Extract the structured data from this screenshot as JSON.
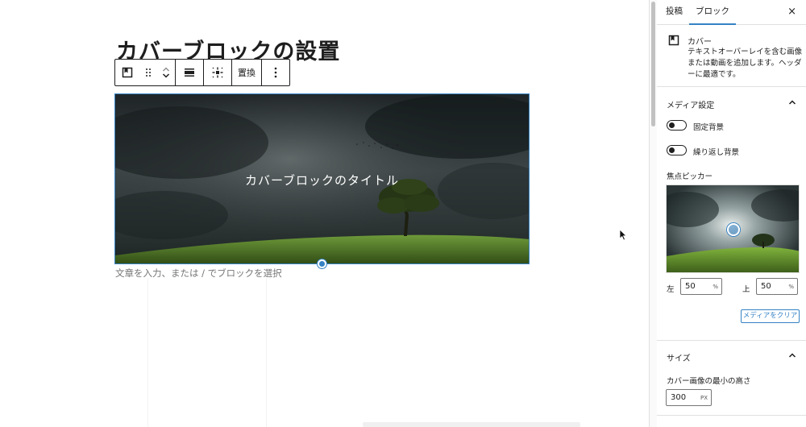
{
  "editor": {
    "title": "カバーブロックの設置",
    "toolbar": {
      "replace_label": "置換"
    },
    "cover": {
      "title": "カバーブロックのタイトル"
    },
    "placeholder": "文章を入力、または / でブロックを選択"
  },
  "sidebar": {
    "tabs": [
      "投稿",
      "ブロック"
    ],
    "active_tab": "ブロック",
    "close_glyph": "×",
    "block": {
      "name": "カバー",
      "description": "テキストオーバーレイを含む画像または動画を追加します。ヘッダーに最適です。"
    },
    "media_settings": {
      "heading": "メディア設定",
      "fixed_background": {
        "label": "固定背景",
        "enabled": false
      },
      "repeated_background": {
        "label": "繰り返し背景",
        "enabled": false
      },
      "focal_picker_label": "焦点ピッカー",
      "left_label": "左",
      "left_value": "50",
      "top_label": "上",
      "top_value": "50",
      "percent_unit": "%",
      "clear_button": "メディアをクリア"
    },
    "size": {
      "heading": "サイズ",
      "min_height_label": "カバー画像の最小の高さ",
      "min_height_value": "300",
      "unit": "PX"
    }
  },
  "colors": {
    "accent": "#3582c4",
    "text": "#1e1e1e",
    "muted": "#757575"
  },
  "icons": [
    "cover-block-icon",
    "drag-handle-icon",
    "chevron-up-icon",
    "chevron-down-icon",
    "align-icon",
    "full-height-icon",
    "more-options-icon",
    "close-icon",
    "chevron-up-icon",
    "mouse-pointer-icon"
  ]
}
